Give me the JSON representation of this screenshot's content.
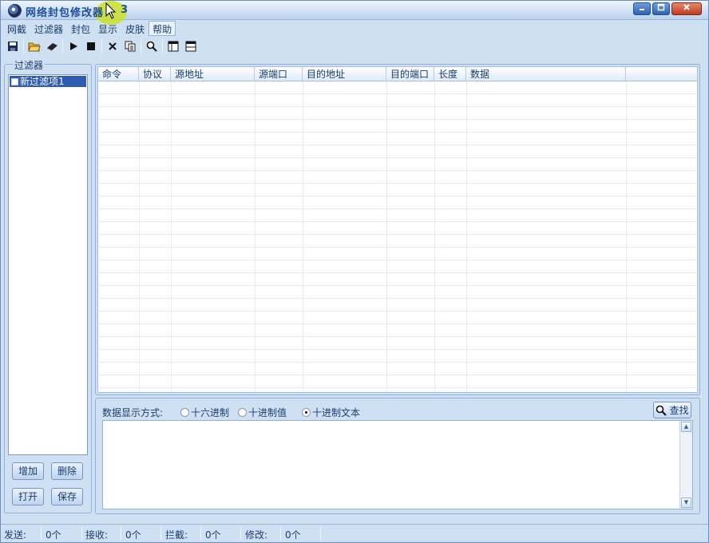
{
  "window": {
    "title": "网络封包修改器",
    "version": "3",
    "controls": [
      "minimize",
      "maximize",
      "close"
    ]
  },
  "menu": [
    "网截",
    "过滤器",
    "封包",
    "显示",
    "皮肤",
    "帮助"
  ],
  "toolbar": {
    "icons": [
      "save-icon",
      "open-folder-icon",
      "open-packets-icon",
      "play-icon",
      "stop-icon",
      "delete-icon",
      "copy-icon",
      "search-icon",
      "layout-icon-1",
      "layout-icon-2"
    ]
  },
  "filters": {
    "legend": "过滤器",
    "items": [
      {
        "label": "新过滤项1",
        "checked": false
      }
    ],
    "buttons": {
      "add": "增加",
      "delete": "删除",
      "open": "打开",
      "save": "保存"
    }
  },
  "packet_table": {
    "columns": [
      "命令",
      "协议",
      "源地址",
      "源端口",
      "目的地址",
      "目的端口",
      "长度",
      "数据"
    ],
    "rows": []
  },
  "data_panel": {
    "label": "数据显示方式:",
    "options": [
      {
        "label": "十六进制",
        "selected": false
      },
      {
        "label": "十进制值",
        "selected": false
      },
      {
        "label": "十进制文本",
        "selected": true
      }
    ],
    "find_label": "查找",
    "content": ""
  },
  "status": {
    "send_label": "发送:",
    "send_value": "0个",
    "recv_label": "接收:",
    "recv_value": "0个",
    "block_label": "拦截:",
    "block_value": "0个",
    "modify_label": "修改:",
    "modify_value": "0个"
  }
}
